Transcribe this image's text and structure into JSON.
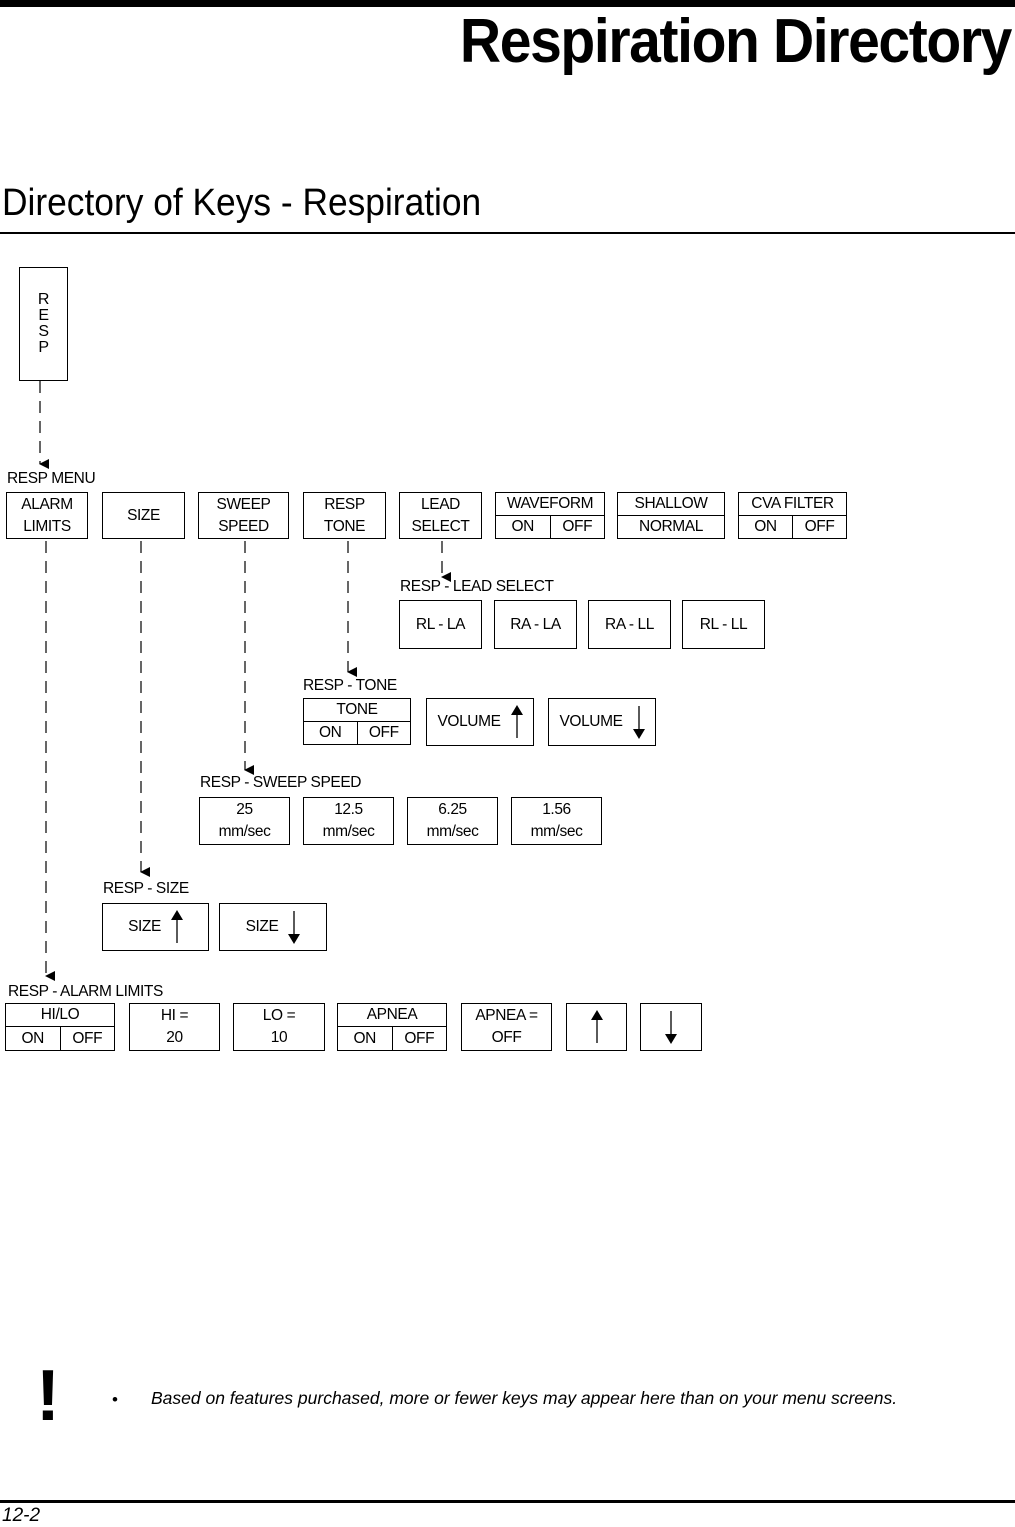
{
  "page": {
    "chapter_title": "Respiration Directory",
    "section_title": "Directory of Keys - Respiration",
    "page_number": "12-2"
  },
  "root_key": {
    "label_letters": [
      "R",
      "E",
      "S",
      "P"
    ]
  },
  "menus": {
    "resp_menu": {
      "title": "RESP MENU",
      "keys": {
        "alarm_limits": [
          "ALARM",
          "LIMITS"
        ],
        "size": "SIZE",
        "sweep_speed": [
          "SWEEP",
          "SPEED"
        ],
        "resp_tone": [
          "RESP",
          "TONE"
        ],
        "lead_select": [
          "LEAD",
          "SELECT"
        ],
        "waveform": {
          "title": "WAVEFORM",
          "options": [
            "ON",
            "OFF"
          ]
        },
        "shallow": {
          "title": "SHALLOW",
          "value": "NORMAL"
        },
        "cva_filter": {
          "title": "CVA FILTER",
          "options": [
            "ON",
            "OFF"
          ]
        }
      }
    },
    "lead_select": {
      "title": "RESP - LEAD SELECT",
      "keys": [
        "RL - LA",
        "RA - LA",
        "RA - LL",
        "RL - LL"
      ]
    },
    "tone": {
      "title": "RESP - TONE",
      "tone_key": {
        "title": "TONE",
        "options": [
          "ON",
          "OFF"
        ]
      },
      "volume_up": "VOLUME",
      "volume_down": "VOLUME"
    },
    "sweep_speed": {
      "title": "RESP - SWEEP SPEED",
      "keys": [
        {
          "value": "25",
          "unit": "mm/sec"
        },
        {
          "value": "12.5",
          "unit": "mm/sec"
        },
        {
          "value": "6.25",
          "unit": "mm/sec"
        },
        {
          "value": "1.56",
          "unit": "mm/sec"
        }
      ]
    },
    "size": {
      "title": "RESP - SIZE",
      "size_up": "SIZE",
      "size_down": "SIZE"
    },
    "alarm_limits": {
      "title": "RESP - ALARM LIMITS",
      "hilo": {
        "title": "HI/LO",
        "options": [
          "ON",
          "OFF"
        ]
      },
      "hi": {
        "label": "HI =",
        "value": "20"
      },
      "lo": {
        "label": "LO =",
        "value": "10"
      },
      "apnea": {
        "title": "APNEA",
        "options": [
          "ON",
          "OFF"
        ]
      },
      "apnea_value": {
        "label": "APNEA =",
        "value": "OFF"
      },
      "up_arrow": "up-arrow-icon",
      "down_arrow": "down-arrow-icon"
    }
  },
  "note": {
    "icon": "exclamation-icon",
    "bullet": "•",
    "text": "Based on features purchased, more or fewer keys may appear here than on your menu screens."
  }
}
